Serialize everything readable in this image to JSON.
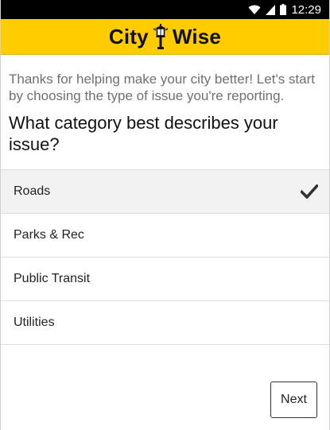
{
  "status_bar": {
    "time": "12:29",
    "icons": [
      "wifi-icon",
      "cell-signal-icon",
      "battery-icon"
    ]
  },
  "header": {
    "logo_left": "City",
    "logo_right": "Wise",
    "logo_icon": "street-lamp-icon",
    "background_color": "#ffcc00"
  },
  "intro_text": "Thanks for helping make your city better! Let's start by choosing the type of issue you're reporting.",
  "question": "What category best describes your issue?",
  "categories": [
    {
      "label": "Roads",
      "selected": true
    },
    {
      "label": "Parks & Rec",
      "selected": false
    },
    {
      "label": "Public Transit",
      "selected": false
    },
    {
      "label": "Utilities",
      "selected": false
    }
  ],
  "next_button": "Next"
}
